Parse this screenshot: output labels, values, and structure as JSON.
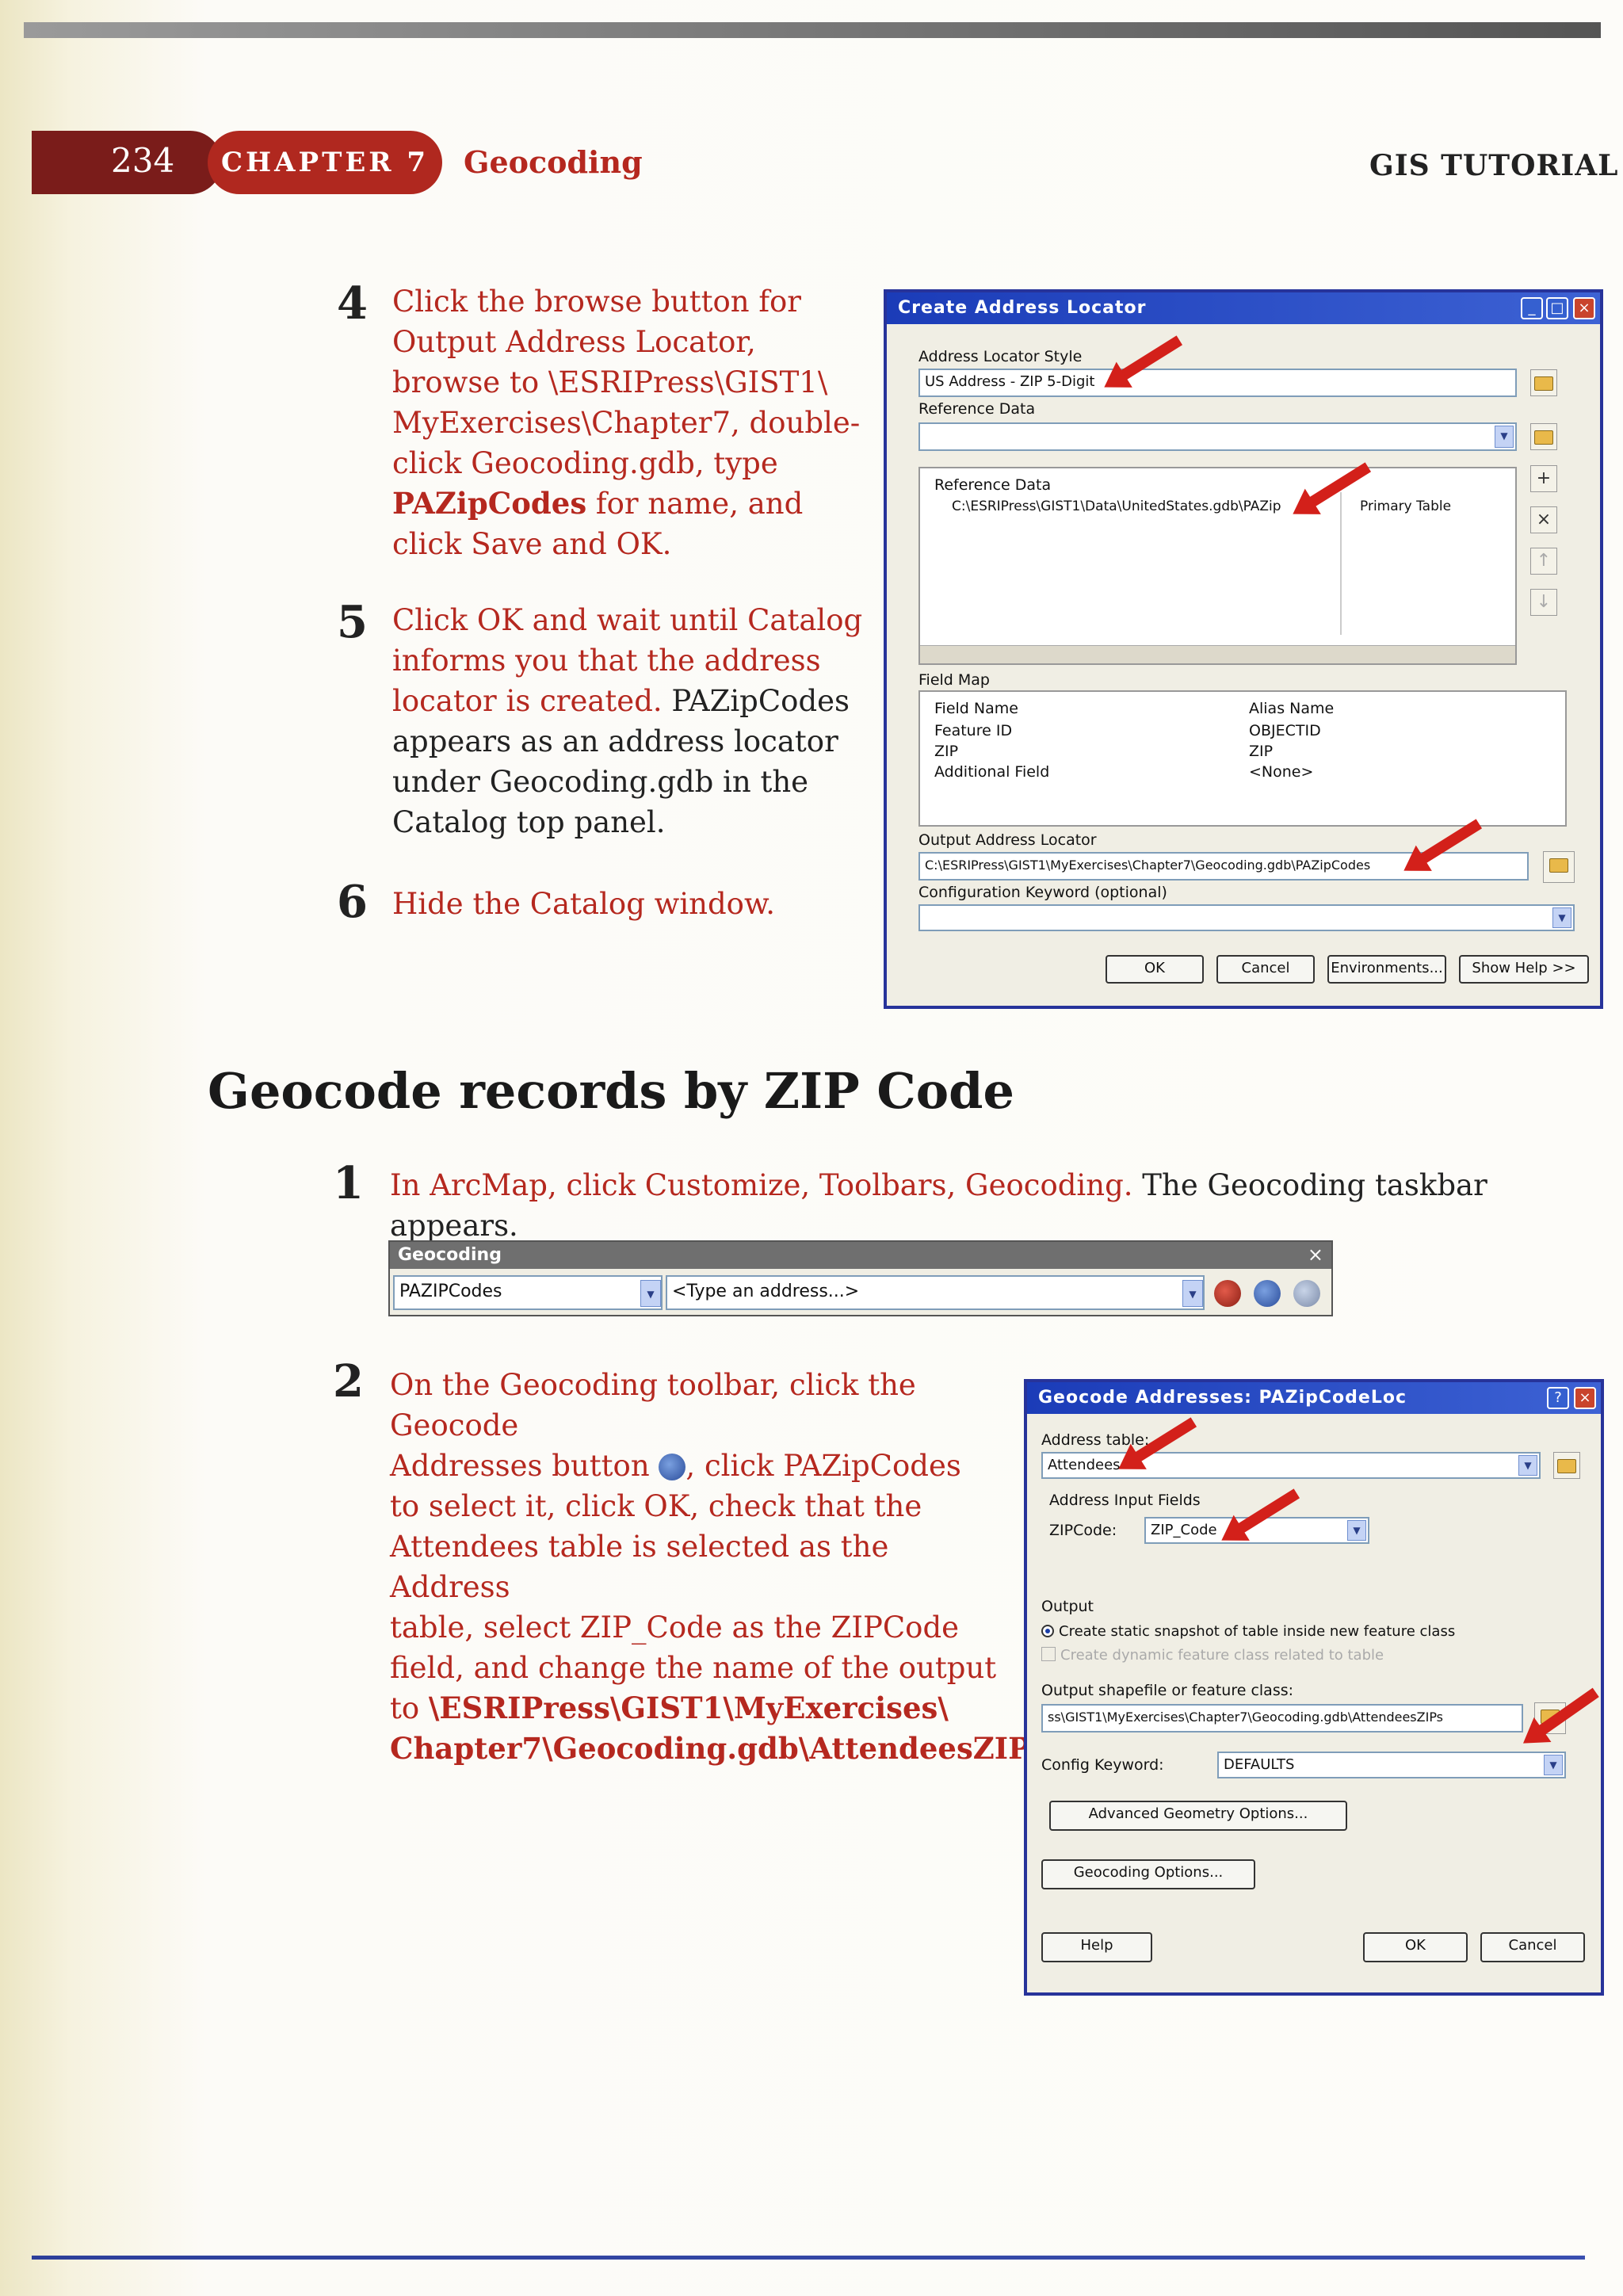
{
  "header": {
    "page_number": "234",
    "chapter_label": "CHAPTER 7",
    "chapter_title": "Geocoding",
    "book_title": "GIS TUTORIAL"
  },
  "steps_top": {
    "s4": {
      "num": "4",
      "a": "Click the browse button for",
      "b": "Output Address Locator,",
      "c": "browse to \\ESRIPress\\GIST1\\",
      "d": "MyExercises\\Chapter7, double-",
      "e": "click Geocoding.gdb, type",
      "f_bold": "PAZipCodes",
      "f_rest": " for name, and",
      "g": "click Save and OK."
    },
    "s5": {
      "num": "5",
      "a": "Click OK and wait until Catalog",
      "b": "informs you that the address",
      "c_red": "locator is created.",
      "c_rest": " PAZipCodes",
      "d": "appears as an address locator",
      "e": "under Geocoding.gdb in the",
      "f": "Catalog top panel."
    },
    "s6": {
      "num": "6",
      "a": "Hide the Catalog window."
    }
  },
  "dialog_create": {
    "title": "Create Address Locator",
    "style_label": "Address Locator Style",
    "style_value": "US Address - ZIP 5-Digit",
    "ref_label": "Reference Data",
    "ref_col": "Reference Data",
    "ref_row_path": "C:\\ESRIPress\\GIST1\\Data\\UnitedStates.gdb\\PAZip",
    "ref_row_role": "Primary Table",
    "field_map_label": "Field Map",
    "fm_col_field": "Field Name",
    "fm_col_alias": "Alias Name",
    "fm_rows": [
      {
        "field": "Feature ID",
        "alias": "OBJECTID"
      },
      {
        "field": "ZIP",
        "alias": "ZIP"
      },
      {
        "field": "Additional Field",
        "alias": "<None>"
      }
    ],
    "output_label": "Output Address Locator",
    "output_value": "C:\\ESRIPress\\GIST1\\MyExercises\\Chapter7\\Geocoding.gdb\\PAZipCodes",
    "keyword_label": "Configuration Keyword (optional)",
    "btn_ok": "OK",
    "btn_cancel": "Cancel",
    "btn_env": "Environments...",
    "btn_help": "Show Help >>"
  },
  "section": {
    "heading": "Geocode records by ZIP Code"
  },
  "step1": {
    "num": "1",
    "red": "In ArcMap, click Customize, Toolbars, Geocoding.",
    "rest": " The Geocoding taskbar appears."
  },
  "toolbar": {
    "title": "Geocoding",
    "locator_value": "PAZIPCodes",
    "address_placeholder": "<Type an address...>"
  },
  "step2": {
    "num": "2",
    "a1": "On the Geocoding toolbar, click the Geocode",
    "b1": "Addresses button",
    "b2": ", click PAZipCodes",
    "c": "to select it, click OK, check that the",
    "d": "Attendees table is selected as the Address",
    "e": "table, select ZIP_Code as the ZIPCode",
    "f": "field, and change the name of the output",
    "g_pre": "to ",
    "g_bold": "\\ESRIPress\\GIST1\\MyExercises\\",
    "h_bold": "Chapter7\\Geocoding.gdb\\AttendeesZIP",
    "h_end": "."
  },
  "dialog_geocode": {
    "title": "Geocode Addresses: PAZipCodeLoc",
    "table_label": "Address table:",
    "table_value": "Attendees",
    "input_fields_label": "Address Input Fields",
    "zip_label": "ZIPCode:",
    "zip_value": "ZIP_Code",
    "output_label": "Output",
    "opt_static": "Create static snapshot of table inside new feature class",
    "opt_dynamic": "Create dynamic feature class related to table",
    "out_class_label": "Output shapefile or feature class:",
    "out_class_value": "ss\\GIST1\\MyExercises\\Chapter7\\Geocoding.gdb\\AttendeesZIPs",
    "config_label": "Config Keyword:",
    "config_value": "DEFAULTS",
    "btn_adv": "Advanced Geometry Options...",
    "btn_geo": "Geocoding Options...",
    "btn_help": "Help",
    "btn_ok": "OK",
    "btn_cancel": "Cancel"
  }
}
